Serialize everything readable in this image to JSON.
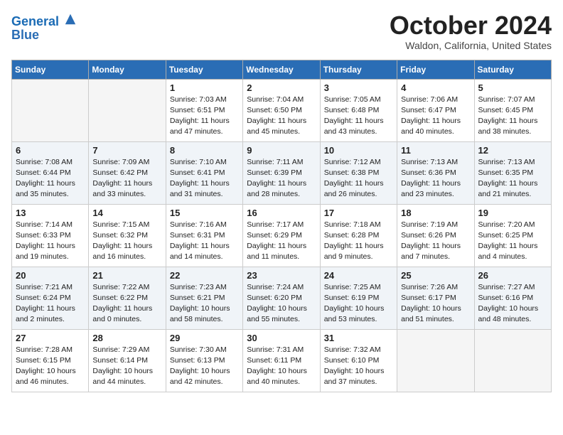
{
  "header": {
    "logo_line1": "General",
    "logo_line2": "Blue",
    "month_title": "October 2024",
    "location": "Waldon, California, United States"
  },
  "days_of_week": [
    "Sunday",
    "Monday",
    "Tuesday",
    "Wednesday",
    "Thursday",
    "Friday",
    "Saturday"
  ],
  "weeks": [
    [
      {
        "day": "",
        "detail": ""
      },
      {
        "day": "",
        "detail": ""
      },
      {
        "day": "1",
        "detail": "Sunrise: 7:03 AM\nSunset: 6:51 PM\nDaylight: 11 hours and 47 minutes."
      },
      {
        "day": "2",
        "detail": "Sunrise: 7:04 AM\nSunset: 6:50 PM\nDaylight: 11 hours and 45 minutes."
      },
      {
        "day": "3",
        "detail": "Sunrise: 7:05 AM\nSunset: 6:48 PM\nDaylight: 11 hours and 43 minutes."
      },
      {
        "day": "4",
        "detail": "Sunrise: 7:06 AM\nSunset: 6:47 PM\nDaylight: 11 hours and 40 minutes."
      },
      {
        "day": "5",
        "detail": "Sunrise: 7:07 AM\nSunset: 6:45 PM\nDaylight: 11 hours and 38 minutes."
      }
    ],
    [
      {
        "day": "6",
        "detail": "Sunrise: 7:08 AM\nSunset: 6:44 PM\nDaylight: 11 hours and 35 minutes."
      },
      {
        "day": "7",
        "detail": "Sunrise: 7:09 AM\nSunset: 6:42 PM\nDaylight: 11 hours and 33 minutes."
      },
      {
        "day": "8",
        "detail": "Sunrise: 7:10 AM\nSunset: 6:41 PM\nDaylight: 11 hours and 31 minutes."
      },
      {
        "day": "9",
        "detail": "Sunrise: 7:11 AM\nSunset: 6:39 PM\nDaylight: 11 hours and 28 minutes."
      },
      {
        "day": "10",
        "detail": "Sunrise: 7:12 AM\nSunset: 6:38 PM\nDaylight: 11 hours and 26 minutes."
      },
      {
        "day": "11",
        "detail": "Sunrise: 7:13 AM\nSunset: 6:36 PM\nDaylight: 11 hours and 23 minutes."
      },
      {
        "day": "12",
        "detail": "Sunrise: 7:13 AM\nSunset: 6:35 PM\nDaylight: 11 hours and 21 minutes."
      }
    ],
    [
      {
        "day": "13",
        "detail": "Sunrise: 7:14 AM\nSunset: 6:33 PM\nDaylight: 11 hours and 19 minutes."
      },
      {
        "day": "14",
        "detail": "Sunrise: 7:15 AM\nSunset: 6:32 PM\nDaylight: 11 hours and 16 minutes."
      },
      {
        "day": "15",
        "detail": "Sunrise: 7:16 AM\nSunset: 6:31 PM\nDaylight: 11 hours and 14 minutes."
      },
      {
        "day": "16",
        "detail": "Sunrise: 7:17 AM\nSunset: 6:29 PM\nDaylight: 11 hours and 11 minutes."
      },
      {
        "day": "17",
        "detail": "Sunrise: 7:18 AM\nSunset: 6:28 PM\nDaylight: 11 hours and 9 minutes."
      },
      {
        "day": "18",
        "detail": "Sunrise: 7:19 AM\nSunset: 6:26 PM\nDaylight: 11 hours and 7 minutes."
      },
      {
        "day": "19",
        "detail": "Sunrise: 7:20 AM\nSunset: 6:25 PM\nDaylight: 11 hours and 4 minutes."
      }
    ],
    [
      {
        "day": "20",
        "detail": "Sunrise: 7:21 AM\nSunset: 6:24 PM\nDaylight: 11 hours and 2 minutes."
      },
      {
        "day": "21",
        "detail": "Sunrise: 7:22 AM\nSunset: 6:22 PM\nDaylight: 11 hours and 0 minutes."
      },
      {
        "day": "22",
        "detail": "Sunrise: 7:23 AM\nSunset: 6:21 PM\nDaylight: 10 hours and 58 minutes."
      },
      {
        "day": "23",
        "detail": "Sunrise: 7:24 AM\nSunset: 6:20 PM\nDaylight: 10 hours and 55 minutes."
      },
      {
        "day": "24",
        "detail": "Sunrise: 7:25 AM\nSunset: 6:19 PM\nDaylight: 10 hours and 53 minutes."
      },
      {
        "day": "25",
        "detail": "Sunrise: 7:26 AM\nSunset: 6:17 PM\nDaylight: 10 hours and 51 minutes."
      },
      {
        "day": "26",
        "detail": "Sunrise: 7:27 AM\nSunset: 6:16 PM\nDaylight: 10 hours and 48 minutes."
      }
    ],
    [
      {
        "day": "27",
        "detail": "Sunrise: 7:28 AM\nSunset: 6:15 PM\nDaylight: 10 hours and 46 minutes."
      },
      {
        "day": "28",
        "detail": "Sunrise: 7:29 AM\nSunset: 6:14 PM\nDaylight: 10 hours and 44 minutes."
      },
      {
        "day": "29",
        "detail": "Sunrise: 7:30 AM\nSunset: 6:13 PM\nDaylight: 10 hours and 42 minutes."
      },
      {
        "day": "30",
        "detail": "Sunrise: 7:31 AM\nSunset: 6:11 PM\nDaylight: 10 hours and 40 minutes."
      },
      {
        "day": "31",
        "detail": "Sunrise: 7:32 AM\nSunset: 6:10 PM\nDaylight: 10 hours and 37 minutes."
      },
      {
        "day": "",
        "detail": ""
      },
      {
        "day": "",
        "detail": ""
      }
    ]
  ]
}
